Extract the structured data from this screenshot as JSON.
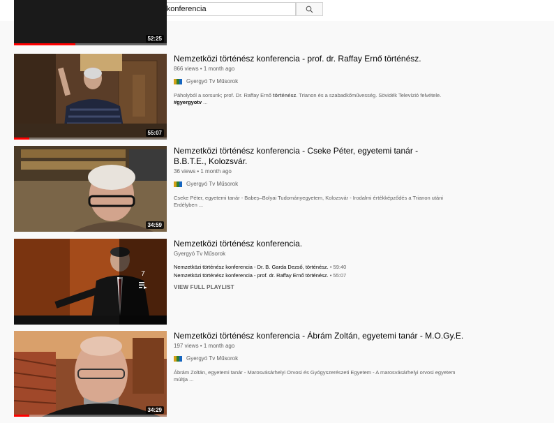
{
  "search": {
    "query": "gyergyotv nemzetközi történész konferencia"
  },
  "videos": [
    {
      "duration": "52:25"
    },
    {
      "title": "Nemzetközi történész konferencia - prof. dr. Raffay Ernő történész.",
      "meta": "866 views • 1 month ago",
      "channel": "Gyergyó Tv Műsorok",
      "desc_a": "Páholyból a sorsunk; prof. Dr. Raffay Ernő ",
      "desc_b": "történész",
      "desc_c": ". Trianon és a szabadkőművesség. Sövidék Televízió felvétele.",
      "desc_d": "#gyergyotv",
      "desc_e": " ...",
      "duration": "55:07"
    },
    {
      "title": "Nemzetközi történész konferencia - Cseke Péter, egyetemi tanár - B.B.T.E., Kolozsvár.",
      "meta": "36 views • 1 month ago",
      "channel": "Gyergyó Tv Műsorok",
      "desc": "Cseke Péter, egyetemi tanár - Babeș–Bolyai Tudományegyetem, Kolozsvár - Irodalmi értékképződés a Trianon utáni Erdélyben ...",
      "duration": "34:59"
    },
    {
      "title": "Nemzetközi történész konferencia.",
      "channel": "Gyergyó Tv Műsorok",
      "playlist_count": "7",
      "items": [
        {
          "title": "Nemzetközi történész konferencia - Dr. B. Garda Dezső, történész.",
          "duration": " • 59:40"
        },
        {
          "title": "Nemzetközi történész konferencia - prof. dr. Raffay Ernő történész.",
          "duration": " • 55:07"
        }
      ],
      "view_all": "VIEW FULL PLAYLIST"
    },
    {
      "title": "Nemzetközi történész konferencia - Ábrám Zoltán, egyetemi tanár - M.O.Gy.E.",
      "meta": "197 views • 1 month ago",
      "channel": "Gyergyó Tv Műsorok",
      "desc": "Ábrám Zoltán, egyetemi tanár - Marosvásárhelyi Orvosi és Gyógyszerészeti Egyetem - A marosvásárhelyi orvosi egyetem múltja ...",
      "duration": "34:29"
    }
  ],
  "colors": {
    "progress": "#ff0000",
    "background": "#f9f9f9",
    "meta": "#606060"
  }
}
